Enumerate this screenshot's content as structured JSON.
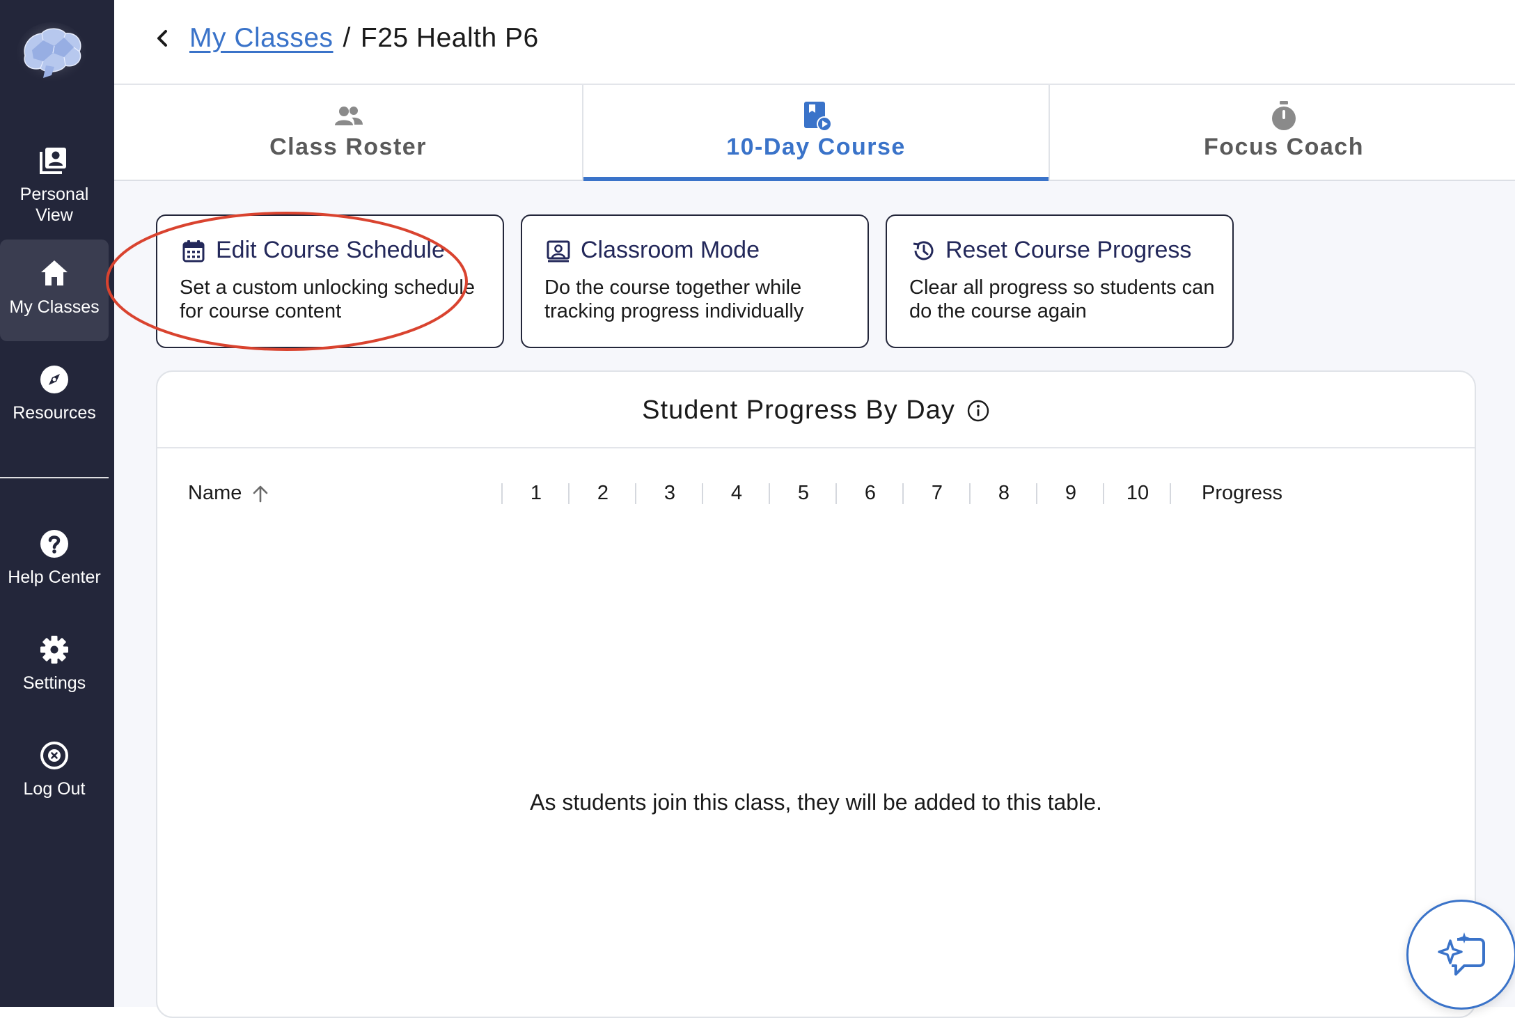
{
  "sidebar": {
    "logo_icon": "brain-logo",
    "items": [
      {
        "label_line1": "Personal",
        "label_line2": "View",
        "icon": "personal-view-icon",
        "active": false
      },
      {
        "label": "My Classes",
        "icon": "home-icon",
        "active": true
      },
      {
        "label": "Resources",
        "icon": "compass-icon",
        "active": false
      },
      {
        "label": "Help Center",
        "icon": "help-icon",
        "active": false
      },
      {
        "label": "Settings",
        "icon": "gear-icon",
        "active": false
      },
      {
        "label": "Log Out",
        "icon": "close-circle-icon",
        "active": false
      }
    ]
  },
  "header": {
    "breadcrumb_link": "My Classes",
    "separator": "/",
    "current_page": "F25 Health P6"
  },
  "tabs": [
    {
      "label": "Class Roster",
      "icon": "people-icon",
      "active": false
    },
    {
      "label": "10-Day Course",
      "icon": "course-play-icon",
      "active": true
    },
    {
      "label": "Focus Coach",
      "icon": "stopwatch-icon",
      "active": false
    }
  ],
  "actions": [
    {
      "title": "Edit Course Schedule",
      "description": "Set a custom unlocking schedule for course content",
      "icon": "calendar-icon"
    },
    {
      "title": "Classroom Mode",
      "description": "Do the course together while tracking progress individually",
      "icon": "presenter-icon"
    },
    {
      "title": "Reset Course Progress",
      "description": "Clear all progress so students can do the course again",
      "icon": "history-icon"
    }
  ],
  "progress_panel": {
    "title": "Student Progress By Day",
    "info_icon": "info-icon",
    "columns": {
      "name": "Name",
      "days": [
        "1",
        "2",
        "3",
        "4",
        "5",
        "6",
        "7",
        "8",
        "9",
        "10"
      ],
      "progress": "Progress"
    },
    "sort_icon": "arrow-up-icon",
    "empty_message": "As students join this class, they will be added to this table."
  },
  "assistant_button": {
    "icon": "ai-chat-sparkle-icon"
  },
  "colors": {
    "sidebar_bg": "#23263a",
    "accent": "#3a73c9",
    "highlight_annotation": "#d9432f",
    "card_title": "#23285a"
  }
}
